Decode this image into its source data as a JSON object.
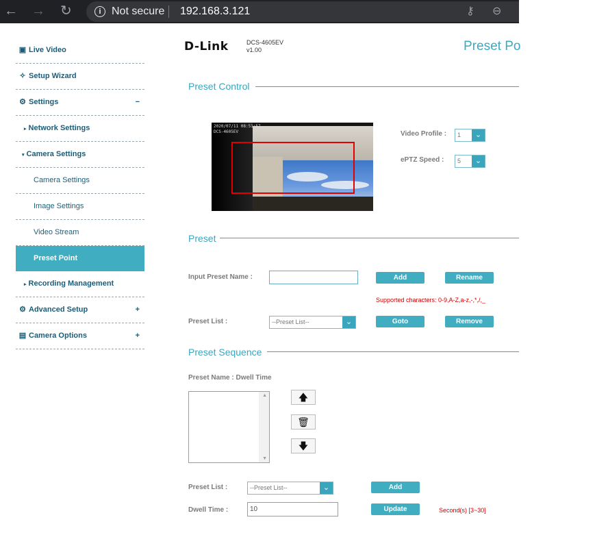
{
  "browser": {
    "back_icon": "←",
    "forward_icon": "→",
    "reload_icon": "↻",
    "security_label": "Not secure",
    "url": "192.168.3.121",
    "key_icon": "⚷",
    "zoom_icon": "⊖"
  },
  "sidebar": {
    "items": [
      {
        "label": "Live Video",
        "icon": "▣",
        "pm": ""
      },
      {
        "label": "Setup Wizard",
        "icon": "✧",
        "pm": ""
      },
      {
        "label": "Settings",
        "icon": "⚙",
        "pm": "−"
      },
      {
        "label": "Network Settings",
        "caret": "▸"
      },
      {
        "label": "Camera Settings",
        "caret": "▾"
      },
      {
        "label": "Camera Settings"
      },
      {
        "label": "Image Settings"
      },
      {
        "label": "Video Stream"
      },
      {
        "label": "Preset Point"
      },
      {
        "label": "Recording Management",
        "caret": "▸"
      },
      {
        "label": "Advanced Setup",
        "icon": "⚙",
        "pm": "+"
      },
      {
        "label": "Camera Options",
        "icon": "▤",
        "pm": "+"
      }
    ]
  },
  "header": {
    "brand": "D-Link",
    "model": "DCS-4605EV",
    "version": "v1.00",
    "page_title": "Preset Po"
  },
  "preset_control": {
    "title": "Preset Control",
    "osd_time": "2020/07/11 08:51:57",
    "osd_name": "DCS-4605EV",
    "video_profile_label": "Video Profile  :",
    "video_profile_value": "1",
    "eptz_speed_label": "ePTZ Speed  :",
    "eptz_speed_value": "5"
  },
  "preset": {
    "title": "Preset",
    "input_label": "Input Preset Name :",
    "input_value": "",
    "add_label": "Add",
    "rename_label": "Rename",
    "supported_note": "Supported characters: 0-9,A-Z,a-z,-,*,/,_",
    "list_label": "Preset List :",
    "list_value": "--Preset List--",
    "goto_label": "Goto",
    "remove_label": "Remove"
  },
  "sequence": {
    "title": "Preset Sequence",
    "header": "Preset Name : Dwell Time",
    "up_icon": "🡅",
    "delete_icon": "🗑",
    "down_icon": "🡇",
    "list_label": "Preset List :",
    "list_value": "--Preset List--",
    "add_label": "Add",
    "dwell_label": "Dwell Time :",
    "dwell_value": "10",
    "update_label": "Update",
    "seconds_note": "Second(s) [3~30]"
  },
  "colors": {
    "accent": "#41adc0",
    "title": "#3aa6be",
    "sidebar_text": "#1b5d78",
    "error": "#cc0000"
  }
}
